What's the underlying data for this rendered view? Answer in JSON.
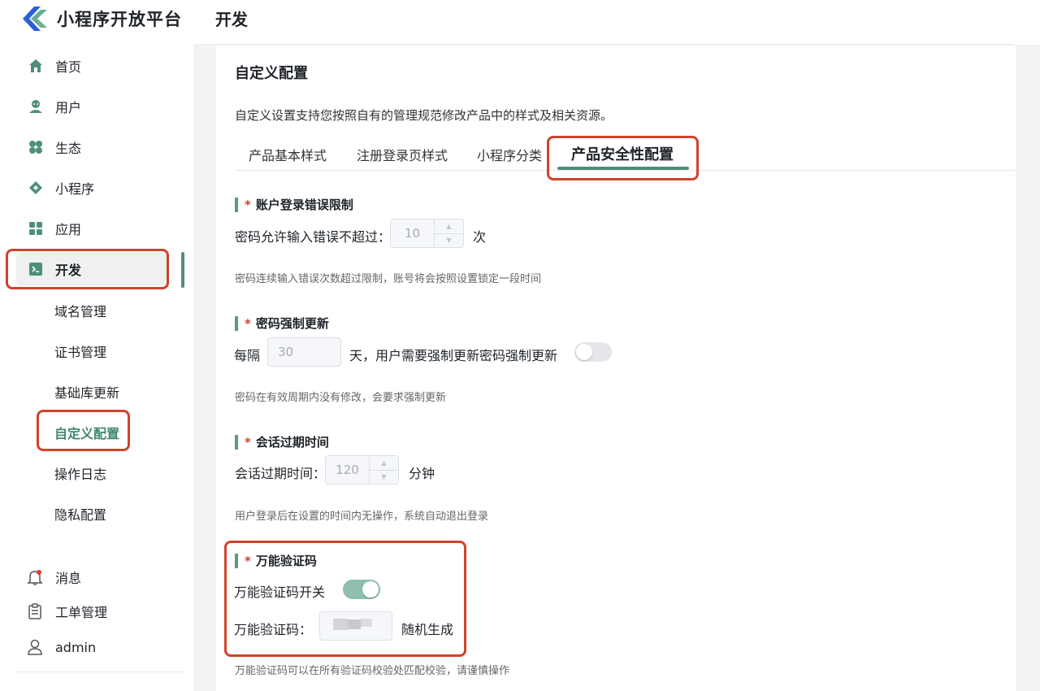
{
  "app": {
    "title": "小程序开放平台",
    "brand_colors": [
      "#2a5fd6",
      "#5aa58c"
    ]
  },
  "header": {
    "title": "开发"
  },
  "sidebar": {
    "items": [
      {
        "label": "首页",
        "icon": "home-icon"
      },
      {
        "label": "用户",
        "icon": "user-icon"
      },
      {
        "label": "生态",
        "icon": "ecosystem-icon"
      },
      {
        "label": "小程序",
        "icon": "diamond-icon"
      },
      {
        "label": "应用",
        "icon": "grid-icon"
      },
      {
        "label": "开发",
        "icon": "terminal-icon",
        "active": true
      }
    ],
    "sub_items": [
      {
        "label": "域名管理"
      },
      {
        "label": "证书管理"
      },
      {
        "label": "基础库更新"
      },
      {
        "label": "自定义配置",
        "active": true
      },
      {
        "label": "操作日志"
      },
      {
        "label": "隐私配置"
      }
    ],
    "bottom_items": [
      {
        "label": "消息",
        "icon": "bell-icon"
      },
      {
        "label": "工单管理",
        "icon": "clipboard-icon"
      },
      {
        "label": "admin",
        "icon": "person-icon"
      }
    ]
  },
  "page": {
    "title": "自定义配置",
    "description": "自定义设置支持您按照自有的管理规范修改产品中的样式及相关资源。",
    "tabs": [
      {
        "label": "产品基本样式"
      },
      {
        "label": "注册登录页样式"
      },
      {
        "label": "小程序分类"
      },
      {
        "label": "产品安全性配置",
        "active": true
      }
    ]
  },
  "sections": {
    "login_limit": {
      "title": "账户登录错误限制",
      "prefix": "密码允许输入错误不超过：",
      "value": "10",
      "suffix": "次",
      "hint": "密码连续输入错误次数超过限制，账号将会按照设置锁定一段时间"
    },
    "password_update": {
      "title": "密码强制更新",
      "prefix": "每隔",
      "value": "30",
      "suffix": "天，用户需要强制更新密码强制更新",
      "switch_on": false,
      "hint": "密码在有效周期内没有修改，会要求强制更新"
    },
    "session_expire": {
      "title": "会话过期时间",
      "prefix": "会话过期时间：",
      "value": "120",
      "suffix": "分钟",
      "hint": "用户登录后在设置的时间内无操作，系统自动退出登录"
    },
    "universal_code": {
      "title": "万能验证码",
      "switch_label": "万能验证码开关",
      "switch_on": true,
      "code_label": "万能验证码：",
      "random_label": "随机生成",
      "hint": "万能验证码可以在所有验证码校验处匹配校验，请谨慎操作"
    }
  },
  "required_mark": "*",
  "accent_color": "#4e8f7a",
  "highlight_color": "#d0432c"
}
